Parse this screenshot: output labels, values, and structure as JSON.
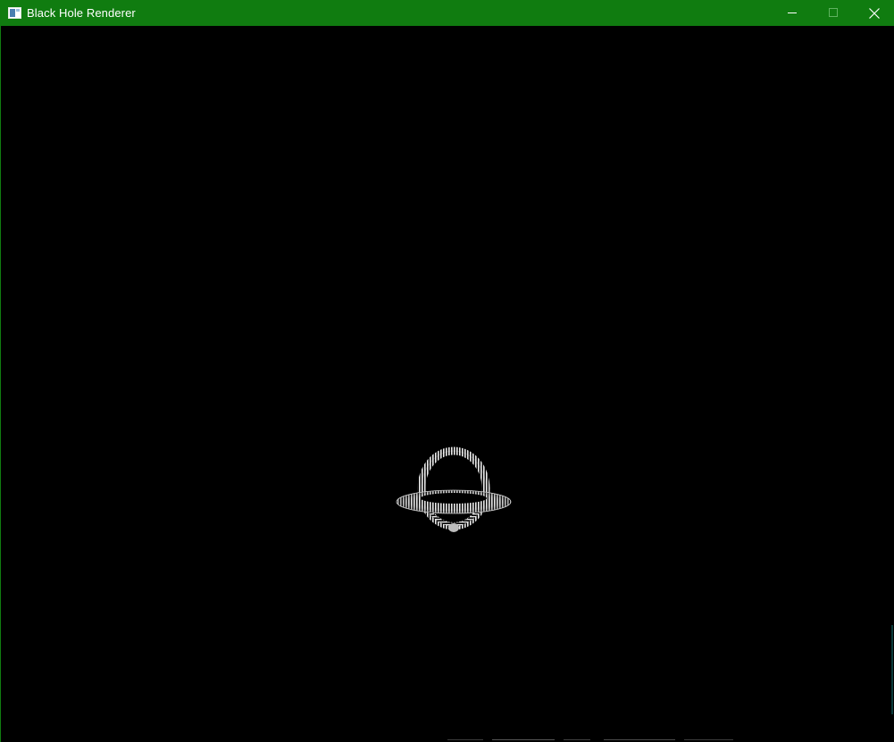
{
  "window": {
    "title": "Black Hole Renderer",
    "accent": "#107c10",
    "title_color": "#ffffff",
    "app_icon": "app-window-icon",
    "controls": {
      "minimize_icon": "minimize-icon",
      "maximize_icon": "maximize-icon",
      "close_icon": "close-icon"
    }
  },
  "render": {
    "background": "#000000",
    "subject": "black-hole-accretion-disk",
    "disk_color": "#e8e8e8"
  }
}
